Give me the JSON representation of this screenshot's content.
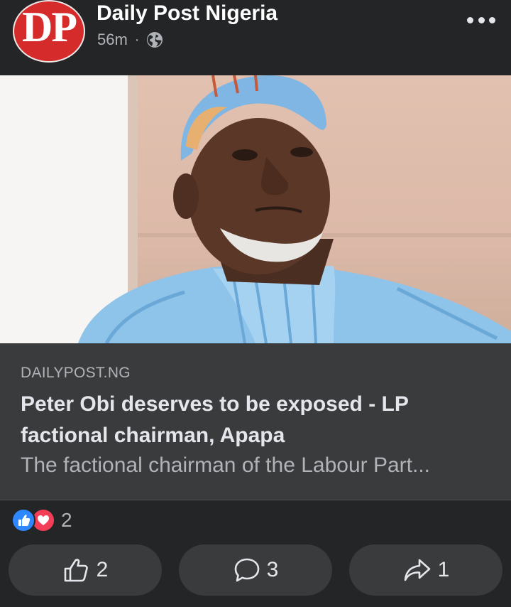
{
  "post": {
    "avatar_text": "DP",
    "page_name": "Daily Post Nigeria",
    "time": "56m",
    "separator": "·",
    "privacy_icon": "globe-icon",
    "more_icon": "more-dots-icon"
  },
  "link": {
    "domain": "DAILYPOST.NG",
    "title": "Peter Obi deserves to be exposed - LP factional chairman, Apapa",
    "description": "The factional chairman of the Labour Part..."
  },
  "reactions": {
    "types": [
      "like-reaction-icon",
      "love-reaction-icon"
    ],
    "total": "2"
  },
  "actions": {
    "like_count": "2",
    "comment_count": "3",
    "share_count": "1"
  },
  "colors": {
    "background": "#242526",
    "card": "#3a3b3c",
    "brand_red": "#d62b2b",
    "like_blue": "#2d88ff",
    "love_red": "#f33e58"
  }
}
